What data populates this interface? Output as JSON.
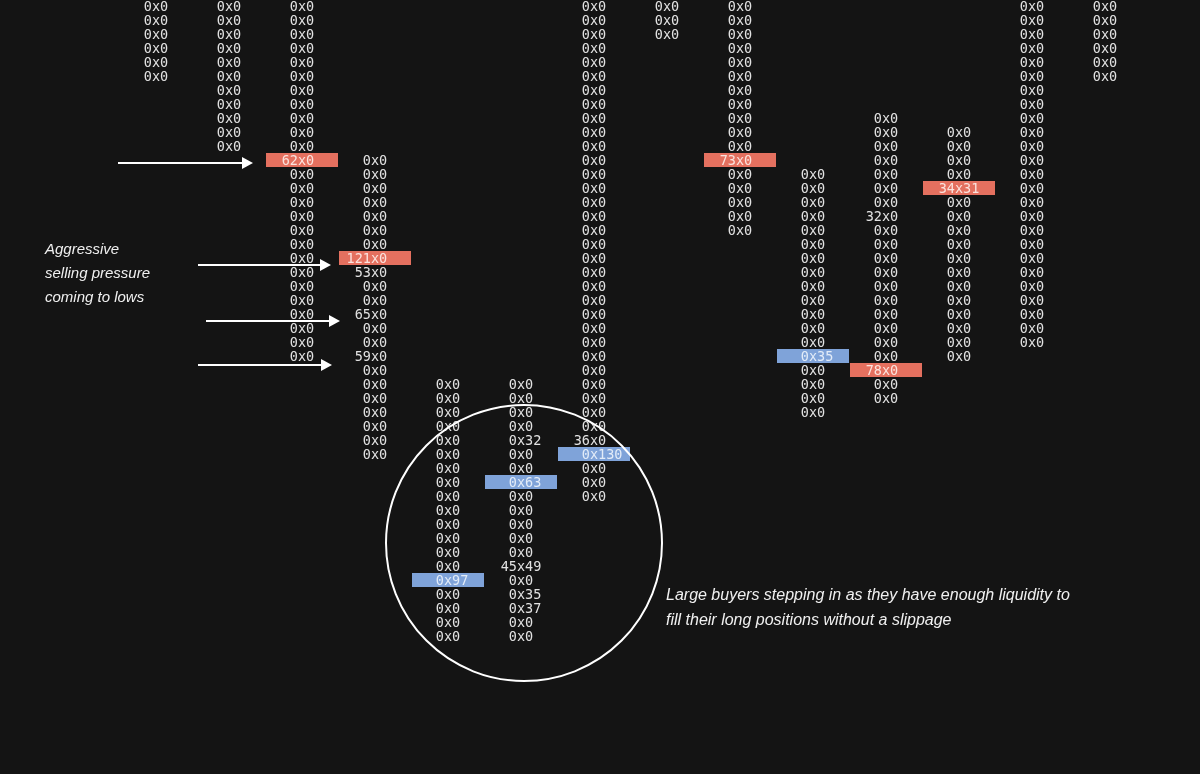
{
  "footprint": {
    "columns": [
      {
        "cells": [
          {
            "text": "0x0",
            "kind": "plain"
          },
          {
            "text": "0x0",
            "kind": "plain"
          },
          {
            "text": "0x0",
            "kind": "plain"
          },
          {
            "text": "0x0",
            "kind": "plain"
          },
          {
            "text": "0x0",
            "kind": "plain"
          },
          {
            "text": "0x0",
            "kind": "plain"
          }
        ]
      },
      {
        "cells": [
          {
            "text": "0x0",
            "kind": "plain"
          },
          {
            "text": "0x0",
            "kind": "plain"
          },
          {
            "text": "0x0",
            "kind": "plain"
          },
          {
            "text": "0x0",
            "kind": "plain"
          },
          {
            "text": "0x0",
            "kind": "plain"
          },
          {
            "text": "0x0",
            "kind": "plain"
          },
          {
            "text": "0x0",
            "kind": "plain"
          },
          {
            "text": "0x0",
            "kind": "plain"
          },
          {
            "text": "0x0",
            "kind": "plain"
          },
          {
            "text": "0x0",
            "kind": "plain"
          },
          {
            "text": "0x0",
            "kind": "plain"
          }
        ]
      },
      {
        "cells": [
          {
            "text": "0x0",
            "kind": "plain"
          },
          {
            "text": "0x0",
            "kind": "plain"
          },
          {
            "text": "0x0",
            "kind": "plain"
          },
          {
            "text": "0x0",
            "kind": "plain"
          },
          {
            "text": "0x0",
            "kind": "plain"
          },
          {
            "text": "0x0",
            "kind": "plain"
          },
          {
            "text": "0x0",
            "kind": "plain"
          },
          {
            "text": "0x0",
            "kind": "plain"
          },
          {
            "text": "0x0",
            "kind": "plain"
          },
          {
            "text": "0x0",
            "kind": "plain"
          },
          {
            "text": "0x0",
            "kind": "plain"
          },
          {
            "text": "62x0",
            "kind": "sell"
          },
          {
            "text": "0x0",
            "kind": "plain"
          },
          {
            "text": "0x0",
            "kind": "plain"
          },
          {
            "text": "0x0",
            "kind": "plain"
          },
          {
            "text": "0x0",
            "kind": "plain"
          },
          {
            "text": "0x0",
            "kind": "plain"
          },
          {
            "text": "0x0",
            "kind": "plain"
          },
          {
            "text": "0x0",
            "kind": "plain"
          },
          {
            "text": "0x0",
            "kind": "plain"
          },
          {
            "text": "0x0",
            "kind": "plain"
          },
          {
            "text": "0x0",
            "kind": "plain"
          },
          {
            "text": "0x0",
            "kind": "plain"
          },
          {
            "text": "0x0",
            "kind": "plain"
          },
          {
            "text": "0x0",
            "kind": "plain"
          },
          {
            "text": "0x0",
            "kind": "plain"
          }
        ]
      },
      {
        "cells": [
          {
            "text": "0x0",
            "kind": "plain"
          },
          {
            "text": "0x0",
            "kind": "plain"
          },
          {
            "text": "0x0",
            "kind": "plain"
          },
          {
            "text": "0x0",
            "kind": "plain"
          },
          {
            "text": "0x0",
            "kind": "plain"
          },
          {
            "text": "0x0",
            "kind": "plain"
          },
          {
            "text": "0x0",
            "kind": "plain"
          },
          {
            "text": "121x0",
            "kind": "sell"
          },
          {
            "text": "53x0",
            "kind": "plain"
          },
          {
            "text": "0x0",
            "kind": "plain"
          },
          {
            "text": "0x0",
            "kind": "plain"
          },
          {
            "text": "65x0",
            "kind": "plain"
          },
          {
            "text": "0x0",
            "kind": "plain"
          },
          {
            "text": "0x0",
            "kind": "plain"
          },
          {
            "text": "59x0",
            "kind": "plain"
          },
          {
            "text": "0x0",
            "kind": "plain"
          },
          {
            "text": "0x0",
            "kind": "plain"
          },
          {
            "text": "0x0",
            "kind": "plain"
          },
          {
            "text": "0x0",
            "kind": "plain"
          },
          {
            "text": "0x0",
            "kind": "plain"
          },
          {
            "text": "0x0",
            "kind": "plain"
          },
          {
            "text": "0x0",
            "kind": "plain"
          }
        ]
      },
      {
        "cells": [
          {
            "text": "0x0",
            "kind": "plain"
          },
          {
            "text": "0x0",
            "kind": "plain"
          },
          {
            "text": "0x0",
            "kind": "plain"
          },
          {
            "text": "0x0",
            "kind": "plain"
          },
          {
            "text": "0x0",
            "kind": "plain"
          },
          {
            "text": "0x0",
            "kind": "plain"
          },
          {
            "text": "0x0",
            "kind": "plain"
          },
          {
            "text": "0x0",
            "kind": "plain"
          },
          {
            "text": "0x0",
            "kind": "plain"
          },
          {
            "text": "0x0",
            "kind": "plain"
          },
          {
            "text": "0x0",
            "kind": "plain"
          },
          {
            "text": "0x0",
            "kind": "plain"
          },
          {
            "text": "0x0",
            "kind": "plain"
          },
          {
            "text": "0x0",
            "kind": "plain"
          },
          {
            "text": "0x97",
            "kind": "buy"
          },
          {
            "text": "0x0",
            "kind": "plain"
          },
          {
            "text": "0x0",
            "kind": "plain"
          },
          {
            "text": "0x0",
            "kind": "plain"
          },
          {
            "text": "0x0",
            "kind": "plain"
          }
        ]
      },
      {
        "cells": [
          {
            "text": "0x0",
            "kind": "plain"
          },
          {
            "text": "0x0",
            "kind": "plain"
          },
          {
            "text": "0x0",
            "kind": "plain"
          },
          {
            "text": "0x0",
            "kind": "plain"
          },
          {
            "text": "0x32",
            "kind": "plain"
          },
          {
            "text": "0x0",
            "kind": "plain"
          },
          {
            "text": "0x0",
            "kind": "plain"
          },
          {
            "text": "0x63",
            "kind": "buy"
          },
          {
            "text": "0x0",
            "kind": "plain"
          },
          {
            "text": "0x0",
            "kind": "plain"
          },
          {
            "text": "0x0",
            "kind": "plain"
          },
          {
            "text": "0x0",
            "kind": "plain"
          },
          {
            "text": "0x0",
            "kind": "plain"
          },
          {
            "text": "45x49",
            "kind": "plain"
          },
          {
            "text": "0x0",
            "kind": "plain"
          },
          {
            "text": "0x35",
            "kind": "plain"
          },
          {
            "text": "0x37",
            "kind": "plain"
          },
          {
            "text": "0x0",
            "kind": "plain"
          },
          {
            "text": "0x0",
            "kind": "plain"
          }
        ]
      },
      {
        "cells": [
          {
            "text": "0x0",
            "kind": "plain"
          },
          {
            "text": "0x0",
            "kind": "plain"
          },
          {
            "text": "0x0",
            "kind": "plain"
          },
          {
            "text": "0x0",
            "kind": "plain"
          },
          {
            "text": "0x0",
            "kind": "plain"
          },
          {
            "text": "0x0",
            "kind": "plain"
          },
          {
            "text": "0x0",
            "kind": "plain"
          },
          {
            "text": "0x0",
            "kind": "plain"
          },
          {
            "text": "0x0",
            "kind": "plain"
          },
          {
            "text": "0x0",
            "kind": "plain"
          },
          {
            "text": "0x0",
            "kind": "plain"
          },
          {
            "text": "0x0",
            "kind": "plain"
          },
          {
            "text": "0x0",
            "kind": "plain"
          },
          {
            "text": "0x0",
            "kind": "plain"
          },
          {
            "text": "0x0",
            "kind": "plain"
          },
          {
            "text": "0x0",
            "kind": "plain"
          },
          {
            "text": "0x0",
            "kind": "plain"
          },
          {
            "text": "0x0",
            "kind": "plain"
          },
          {
            "text": "0x0",
            "kind": "plain"
          },
          {
            "text": "0x0",
            "kind": "plain"
          },
          {
            "text": "0x0",
            "kind": "plain"
          },
          {
            "text": "0x0",
            "kind": "plain"
          },
          {
            "text": "0x0",
            "kind": "plain"
          },
          {
            "text": "0x0",
            "kind": "plain"
          },
          {
            "text": "0x0",
            "kind": "plain"
          },
          {
            "text": "0x0",
            "kind": "plain"
          },
          {
            "text": "0x0",
            "kind": "plain"
          },
          {
            "text": "0x0",
            "kind": "plain"
          },
          {
            "text": "0x0",
            "kind": "plain"
          },
          {
            "text": "0x0",
            "kind": "plain"
          },
          {
            "text": "0x0",
            "kind": "plain"
          },
          {
            "text": "36x0",
            "kind": "plain"
          },
          {
            "text": "0x130",
            "kind": "buy"
          },
          {
            "text": "0x0",
            "kind": "plain"
          },
          {
            "text": "0x0",
            "kind": "plain"
          },
          {
            "text": "0x0",
            "kind": "plain"
          }
        ]
      },
      {
        "cells": [
          {
            "text": "0x0",
            "kind": "plain"
          },
          {
            "text": "0x0",
            "kind": "plain"
          },
          {
            "text": "0x0",
            "kind": "plain"
          }
        ]
      },
      {
        "cells": [
          {
            "text": "0x0",
            "kind": "plain"
          },
          {
            "text": "0x0",
            "kind": "plain"
          },
          {
            "text": "0x0",
            "kind": "plain"
          },
          {
            "text": "0x0",
            "kind": "plain"
          },
          {
            "text": "0x0",
            "kind": "plain"
          },
          {
            "text": "0x0",
            "kind": "plain"
          },
          {
            "text": "0x0",
            "kind": "plain"
          },
          {
            "text": "0x0",
            "kind": "plain"
          },
          {
            "text": "0x0",
            "kind": "plain"
          },
          {
            "text": "0x0",
            "kind": "plain"
          },
          {
            "text": "0x0",
            "kind": "plain"
          },
          {
            "text": "73x0",
            "kind": "sell"
          },
          {
            "text": "0x0",
            "kind": "plain"
          },
          {
            "text": "0x0",
            "kind": "plain"
          },
          {
            "text": "0x0",
            "kind": "plain"
          },
          {
            "text": "0x0",
            "kind": "plain"
          },
          {
            "text": "0x0",
            "kind": "plain"
          }
        ]
      },
      {
        "cells": [
          {
            "text": "0x0",
            "kind": "plain"
          },
          {
            "text": "0x0",
            "kind": "plain"
          },
          {
            "text": "0x0",
            "kind": "plain"
          },
          {
            "text": "0x0",
            "kind": "plain"
          },
          {
            "text": "0x0",
            "kind": "plain"
          },
          {
            "text": "0x0",
            "kind": "plain"
          },
          {
            "text": "0x0",
            "kind": "plain"
          },
          {
            "text": "0x0",
            "kind": "plain"
          },
          {
            "text": "0x0",
            "kind": "plain"
          },
          {
            "text": "0x0",
            "kind": "plain"
          },
          {
            "text": "0x0",
            "kind": "plain"
          },
          {
            "text": "0x0",
            "kind": "plain"
          },
          {
            "text": "0x0",
            "kind": "plain"
          },
          {
            "text": "0x35",
            "kind": "buy"
          },
          {
            "text": "0x0",
            "kind": "plain"
          },
          {
            "text": "0x0",
            "kind": "plain"
          },
          {
            "text": "0x0",
            "kind": "plain"
          },
          {
            "text": "0x0",
            "kind": "plain"
          }
        ]
      },
      {
        "cells": [
          {
            "text": "0x0",
            "kind": "plain"
          },
          {
            "text": "0x0",
            "kind": "plain"
          },
          {
            "text": "0x0",
            "kind": "plain"
          },
          {
            "text": "0x0",
            "kind": "plain"
          },
          {
            "text": "0x0",
            "kind": "plain"
          },
          {
            "text": "0x0",
            "kind": "plain"
          },
          {
            "text": "0x0",
            "kind": "plain"
          },
          {
            "text": "32x0",
            "kind": "plain"
          },
          {
            "text": "0x0",
            "kind": "plain"
          },
          {
            "text": "0x0",
            "kind": "plain"
          },
          {
            "text": "0x0",
            "kind": "plain"
          },
          {
            "text": "0x0",
            "kind": "plain"
          },
          {
            "text": "0x0",
            "kind": "plain"
          },
          {
            "text": "0x0",
            "kind": "plain"
          },
          {
            "text": "0x0",
            "kind": "plain"
          },
          {
            "text": "0x0",
            "kind": "plain"
          },
          {
            "text": "0x0",
            "kind": "plain"
          },
          {
            "text": "0x0",
            "kind": "plain"
          },
          {
            "text": "78x0",
            "kind": "sell"
          },
          {
            "text": "0x0",
            "kind": "plain"
          },
          {
            "text": "0x0",
            "kind": "plain"
          }
        ]
      },
      {
        "cells": [
          {
            "text": "0x0",
            "kind": "plain"
          },
          {
            "text": "0x0",
            "kind": "plain"
          },
          {
            "text": "0x0",
            "kind": "plain"
          },
          {
            "text": "0x0",
            "kind": "plain"
          },
          {
            "text": "34x31",
            "kind": "sell"
          },
          {
            "text": "0x0",
            "kind": "plain"
          },
          {
            "text": "0x0",
            "kind": "plain"
          },
          {
            "text": "0x0",
            "kind": "plain"
          },
          {
            "text": "0x0",
            "kind": "plain"
          },
          {
            "text": "0x0",
            "kind": "plain"
          },
          {
            "text": "0x0",
            "kind": "plain"
          },
          {
            "text": "0x0",
            "kind": "plain"
          },
          {
            "text": "0x0",
            "kind": "plain"
          },
          {
            "text": "0x0",
            "kind": "plain"
          },
          {
            "text": "0x0",
            "kind": "plain"
          },
          {
            "text": "0x0",
            "kind": "plain"
          },
          {
            "text": "0x0",
            "kind": "plain"
          }
        ]
      },
      {
        "cells": [
          {
            "text": "0x0",
            "kind": "plain"
          },
          {
            "text": "0x0",
            "kind": "plain"
          },
          {
            "text": "0x0",
            "kind": "plain"
          },
          {
            "text": "0x0",
            "kind": "plain"
          },
          {
            "text": "0x0",
            "kind": "plain"
          },
          {
            "text": "0x0",
            "kind": "plain"
          },
          {
            "text": "0x0",
            "kind": "plain"
          },
          {
            "text": "0x0",
            "kind": "plain"
          },
          {
            "text": "0x0",
            "kind": "plain"
          },
          {
            "text": "0x0",
            "kind": "plain"
          },
          {
            "text": "0x0",
            "kind": "plain"
          },
          {
            "text": "0x0",
            "kind": "plain"
          },
          {
            "text": "0x0",
            "kind": "plain"
          },
          {
            "text": "0x0",
            "kind": "plain"
          },
          {
            "text": "0x0",
            "kind": "plain"
          },
          {
            "text": "0x0",
            "kind": "plain"
          },
          {
            "text": "0x0",
            "kind": "plain"
          },
          {
            "text": "0x0",
            "kind": "plain"
          },
          {
            "text": "0x0",
            "kind": "plain"
          },
          {
            "text": "0x0",
            "kind": "plain"
          },
          {
            "text": "0x0",
            "kind": "plain"
          },
          {
            "text": "0x0",
            "kind": "plain"
          },
          {
            "text": "0x0",
            "kind": "plain"
          },
          {
            "text": "0x0",
            "kind": "plain"
          },
          {
            "text": "0x0",
            "kind": "plain"
          }
        ]
      },
      {
        "cells": [
          {
            "text": "0x0",
            "kind": "plain"
          },
          {
            "text": "0x0",
            "kind": "plain"
          },
          {
            "text": "0x0",
            "kind": "plain"
          },
          {
            "text": "0x0",
            "kind": "plain"
          },
          {
            "text": "0x0",
            "kind": "plain"
          },
          {
            "text": "0x0",
            "kind": "plain"
          }
        ]
      }
    ]
  },
  "notes": [
    {
      "lines": [
        "Aggressive",
        "selling pressure",
        "coming to lows"
      ]
    },
    {
      "lines": [
        "Large buyers stepping in as they have enough liquidity to",
        "fill their long positions without a slippage"
      ]
    }
  ]
}
